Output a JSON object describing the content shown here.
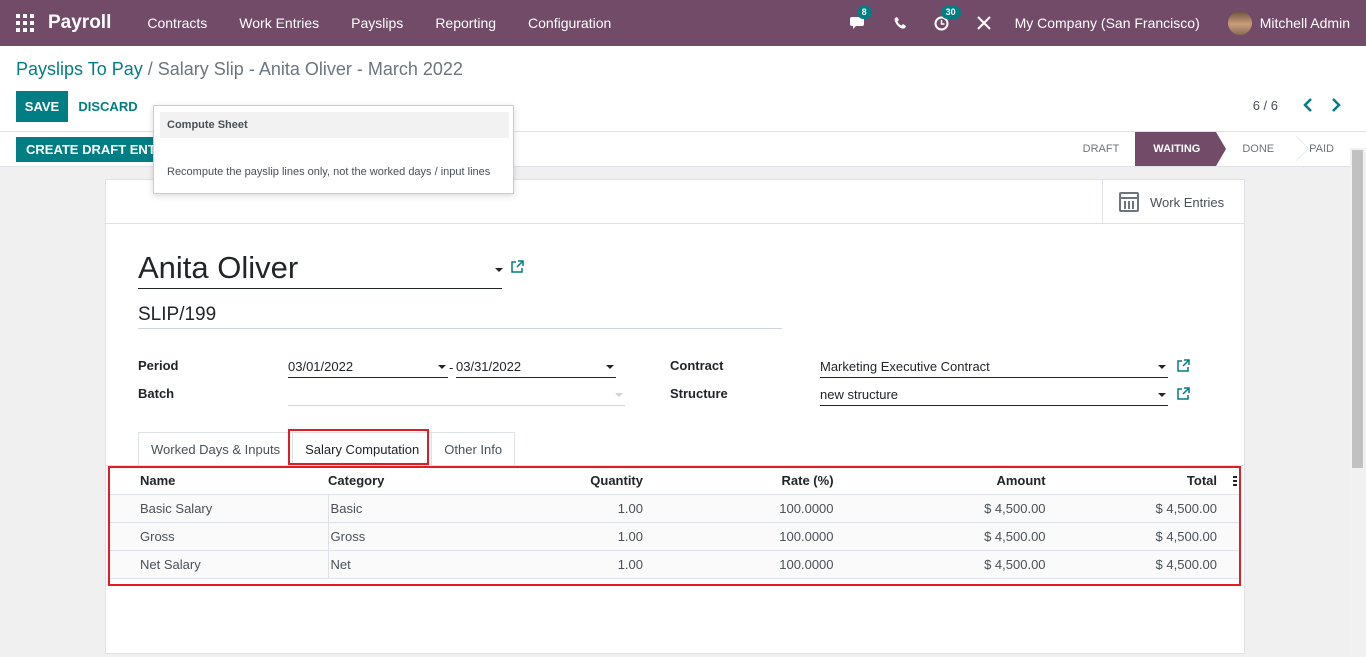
{
  "navbar": {
    "app_name": "Payroll",
    "menu": [
      "Contracts",
      "Work Entries",
      "Payslips",
      "Reporting",
      "Configuration"
    ],
    "messages_count": "8",
    "activities_count": "30",
    "company": "My Company (San Francisco)",
    "user": "Mitchell Admin"
  },
  "breadcrumb": {
    "parent": "Payslips To Pay",
    "separator": "/",
    "current": "Salary Slip - Anita Oliver - March 2022"
  },
  "actions": {
    "save": "SAVE",
    "discard": "DISCARD"
  },
  "pager": {
    "value": "6 / 6"
  },
  "statusbar": {
    "draft_button": "CREATE DRAFT ENTRY",
    "stages": [
      "DRAFT",
      "WAITING",
      "DONE",
      "PAID"
    ],
    "active_stage": "WAITING"
  },
  "tooltip": {
    "title": "Compute Sheet",
    "body": "Recompute the payslip lines only, not the worked days / input lines"
  },
  "button_box": {
    "work_entries": "Work Entries"
  },
  "form": {
    "employee": "Anita Oliver",
    "reference": "SLIP/199",
    "period_label": "Period",
    "period_from": "03/01/2022",
    "period_sep": "-",
    "period_to": "03/31/2022",
    "batch_label": "Batch",
    "batch_value": "",
    "contract_label": "Contract",
    "contract_value": "Marketing Executive Contract",
    "structure_label": "Structure",
    "structure_value": "new structure"
  },
  "tabs": [
    "Worked Days & Inputs",
    "Salary Computation",
    "Other Info"
  ],
  "active_tab": "Salary Computation",
  "table": {
    "headers": {
      "name": "Name",
      "category": "Category",
      "quantity": "Quantity",
      "rate": "Rate (%)",
      "amount": "Amount",
      "total": "Total"
    },
    "rows": [
      {
        "name": "Basic Salary",
        "category": "Basic",
        "quantity": "1.00",
        "rate": "100.0000",
        "amount": "$ 4,500.00",
        "total": "$ 4,500.00"
      },
      {
        "name": "Gross",
        "category": "Gross",
        "quantity": "1.00",
        "rate": "100.0000",
        "amount": "$ 4,500.00",
        "total": "$ 4,500.00"
      },
      {
        "name": "Net Salary",
        "category": "Net",
        "quantity": "1.00",
        "rate": "100.0000",
        "amount": "$ 4,500.00",
        "total": "$ 4,500.00"
      }
    ]
  },
  "colors": {
    "brand": "#714b67",
    "accent": "#017e84",
    "highlight": "#e31b23"
  }
}
